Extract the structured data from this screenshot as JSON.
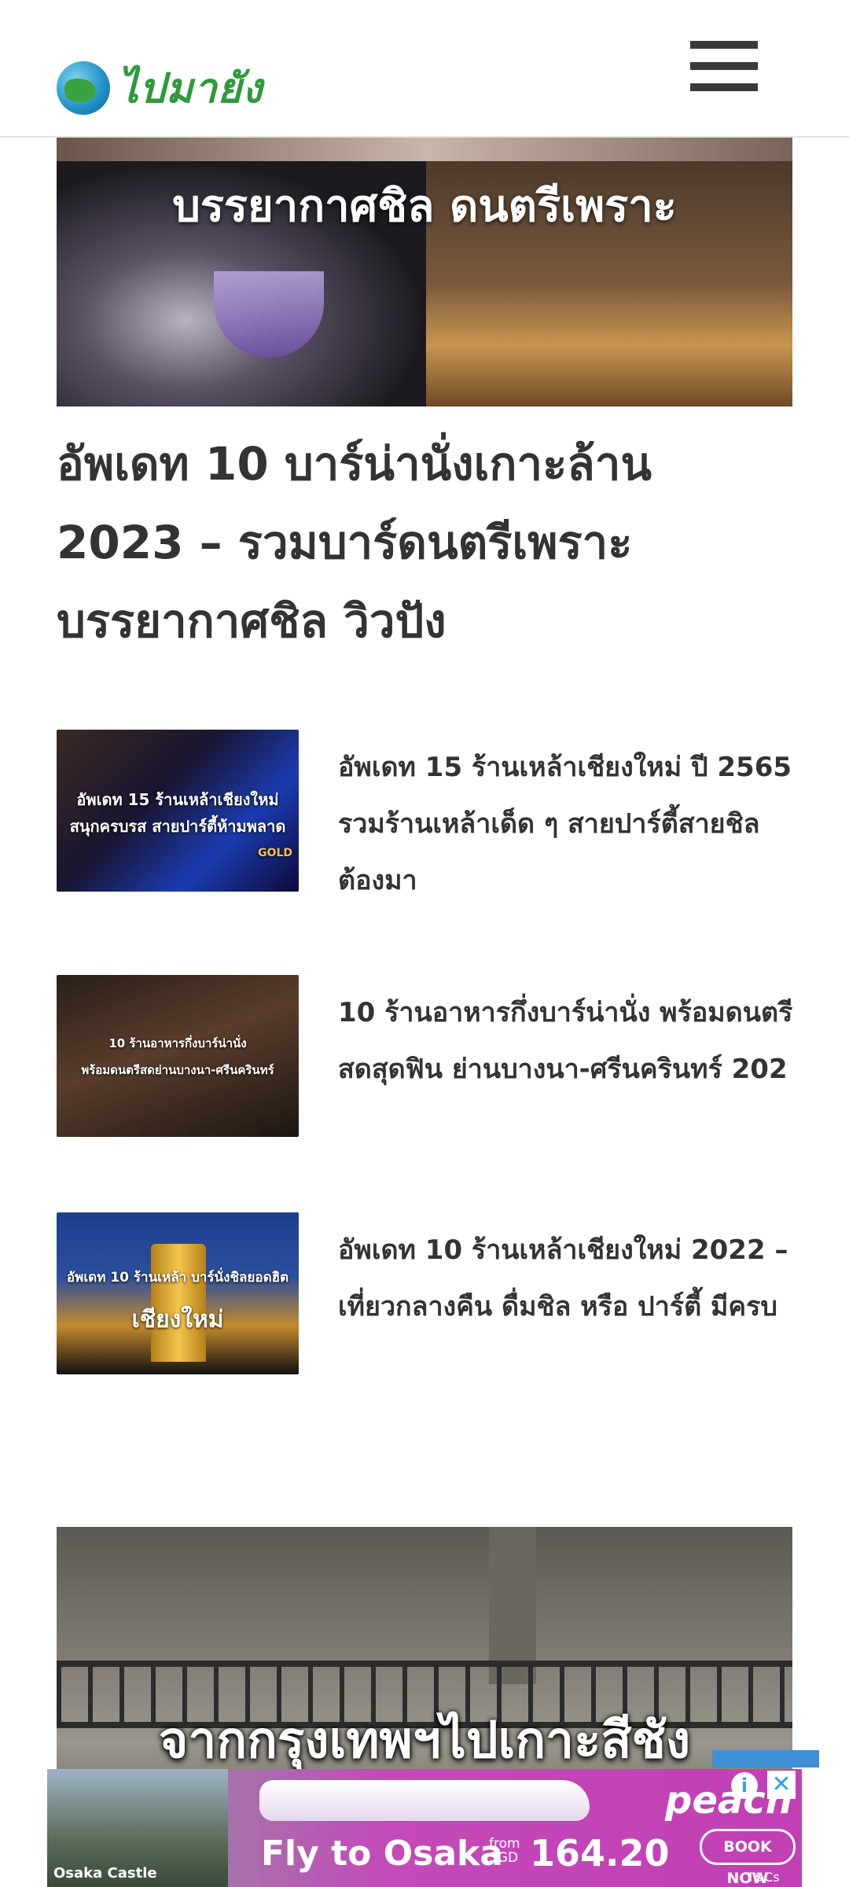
{
  "header": {
    "logo_text": "ไปมายัง",
    "menu_icon": "hamburger-menu-icon"
  },
  "hero": {
    "image_text_line": "บรรยากาศชิล ดนตรีเพราะ",
    "title": "อัพเดท 10 บาร์น่านั่งเกาะล้าน 2023 – รวมบาร์ดนตรีเพราะ บรรยากาศชิล วิวปัง"
  },
  "articles": [
    {
      "thumb_line1": "อัพเดท 15 ร้านเหล้าเชียงใหม่",
      "thumb_line2": "สนุกครบรส สายปาร์ตี้ห้ามพลาด",
      "thumb_badge": "GOLD",
      "title_line1": "อัพเดท 15 ร้านเหล้าเชียงใหม่ ปี 2565",
      "title_line2": "รวมร้านเหล้าเด็ด ๆ สายปาร์ตี้สายชิล",
      "title_line3": "ต้องมา"
    },
    {
      "thumb_line1": "10 ร้านอาหารกึ่งบาร์น่านั่ง",
      "thumb_line2": "พร้อมดนตรีสดย่านบางนา-ศรีนครินทร์",
      "title_line1": "10 ร้านอาหารกึ่งบาร์น่านั่ง พร้อมดนตรี",
      "title_line2": "สดสุดฟิน ย่านบางนา-ศรีนครินทร์ 202"
    },
    {
      "thumb_line1": "อัพเดท 10 ร้านเหล้า บาร์นั่งชิลยอดฮิต",
      "thumb_line2": "เชียงใหม่",
      "title_line1": "อัพเดท 10 ร้านเหล้าเชียงใหม่ 2022 –",
      "title_line2": "เที่ยวกลางคืน ดื่มชิล หรือ ปาร์ตี้ มีครบ"
    }
  ],
  "second_feature": {
    "image_text": "จากกรุงเทพฯไปเกาะสีชัง"
  },
  "ad": {
    "caption": "Osaka Castle",
    "main_text": "Fly to Osaka",
    "from_line1": "from",
    "from_line2": "SGD",
    "price": "164.20",
    "brand": "peach",
    "cta": "BOOK NOW",
    "terms": "T&Cs apply.",
    "info_label": "i",
    "close_label": "✕"
  }
}
